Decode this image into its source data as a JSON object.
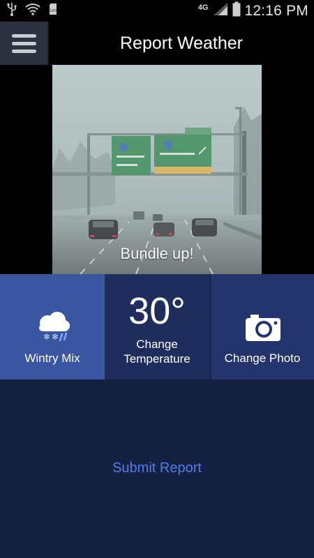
{
  "status_bar": {
    "time": "12:16 PM",
    "network": "4G",
    "battery_level_text": "100",
    "icons": [
      "usb-icon",
      "wifi-icon",
      "sd-card-icon",
      "signal-icon",
      "battery-icon"
    ]
  },
  "app_bar": {
    "title": "Report Weather",
    "menu_icon": "hamburger-menu-icon"
  },
  "photo": {
    "caption": "Bundle up!",
    "description_icon": "photo-image"
  },
  "tiles": {
    "condition": {
      "label": "Wintry Mix",
      "icon": "wintry-mix-icon"
    },
    "temperature": {
      "value": "30°",
      "label_line1": "Change",
      "label_line2": "Temperature"
    },
    "photo": {
      "label": "Change Photo",
      "icon": "camera-icon"
    }
  },
  "actions": {
    "submit_label": "Submit Report"
  },
  "colors": {
    "condition_tile": "#3a56a0",
    "temperature_tile": "#1f2d5c",
    "photo_tile": "#23346c",
    "bottom_panel": "#152142",
    "submit_text": "#4f7fe6"
  }
}
